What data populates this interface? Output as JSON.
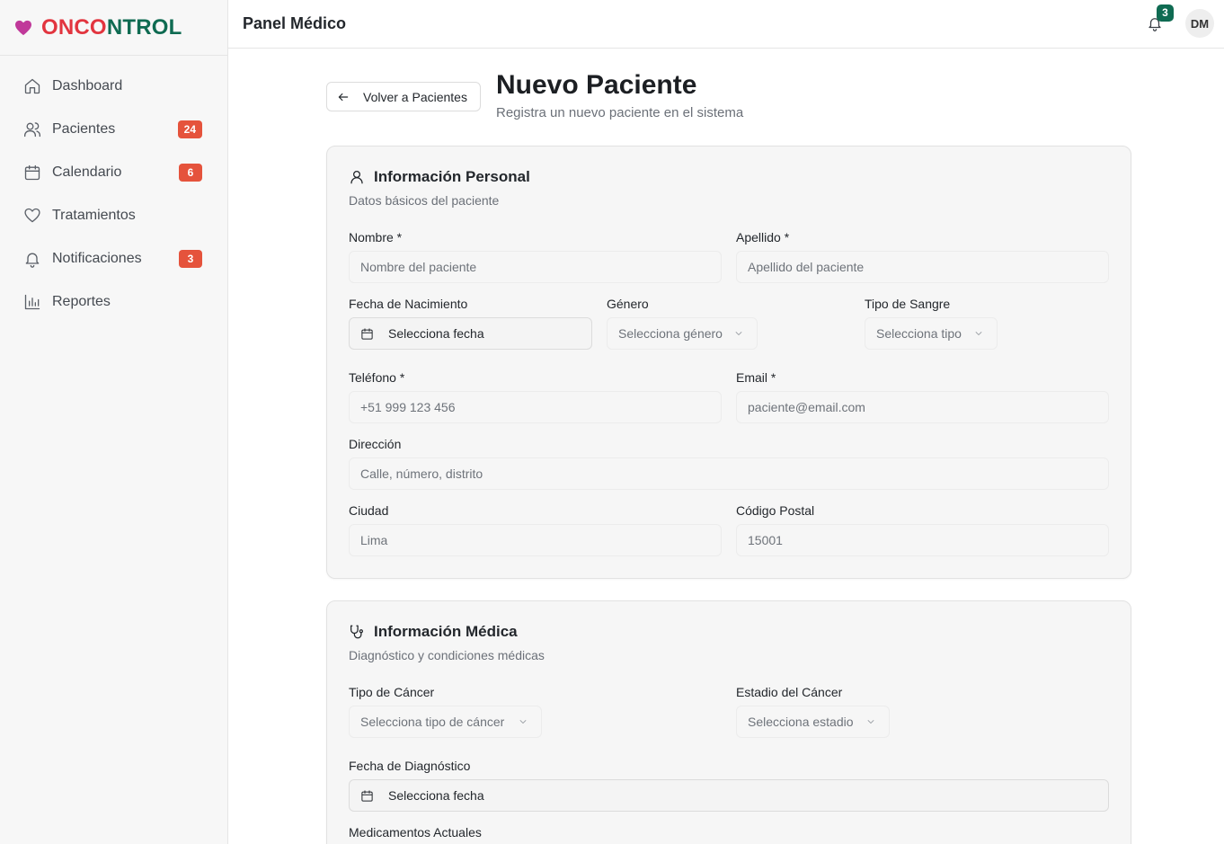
{
  "brand": {
    "heart_color": "#c0399a",
    "name_part1": "ONCO",
    "name_part2": "NTROL"
  },
  "sidebar": {
    "items": [
      {
        "label": "Dashboard",
        "icon": "home-icon",
        "badge": ""
      },
      {
        "label": "Pacientes",
        "icon": "users-icon",
        "badge": "24"
      },
      {
        "label": "Calendario",
        "icon": "calendar-icon",
        "badge": "6"
      },
      {
        "label": "Tratamientos",
        "icon": "heart-icon",
        "badge": ""
      },
      {
        "label": "Notificaciones",
        "icon": "bell-icon",
        "badge": "3"
      },
      {
        "label": "Reportes",
        "icon": "bar-chart-icon",
        "badge": ""
      }
    ]
  },
  "header": {
    "title": "Panel Médico",
    "notification_count": "3",
    "avatar_initials": "DM"
  },
  "page": {
    "back_label": "Volver a Pacientes",
    "title": "Nuevo Paciente",
    "subtitle": "Registra un nuevo paciente en el sistema"
  },
  "personal": {
    "title": "Información Personal",
    "description": "Datos básicos del paciente",
    "nombre_label": "Nombre *",
    "nombre_placeholder": "Nombre del paciente",
    "apellido_label": "Apellido *",
    "apellido_placeholder": "Apellido del paciente",
    "nacimiento_label": "Fecha de Nacimiento",
    "nacimiento_value": "Selecciona fecha",
    "genero_label": "Género",
    "genero_value": "Selecciona género",
    "sangre_label": "Tipo de Sangre",
    "sangre_value": "Selecciona tipo",
    "telefono_label": "Teléfono *",
    "telefono_placeholder": "+51 999 123 456",
    "email_label": "Email *",
    "email_placeholder": "paciente@email.com",
    "direccion_label": "Dirección",
    "direccion_placeholder": "Calle, número, distrito",
    "ciudad_label": "Ciudad",
    "ciudad_placeholder": "Lima",
    "postal_label": "Código Postal",
    "postal_placeholder": "15001"
  },
  "medical": {
    "title": "Información Médica",
    "description": "Diagnóstico y condiciones médicas",
    "tipo_cancer_label": "Tipo de Cáncer",
    "tipo_cancer_value": "Selecciona tipo de cáncer",
    "estadio_label": "Estadio del Cáncer",
    "estadio_value": "Selecciona estadio",
    "diagnostico_label": "Fecha de Diagnóstico",
    "diagnostico_value": "Selecciona fecha",
    "medicamentos_label": "Medicamentos Actuales"
  }
}
